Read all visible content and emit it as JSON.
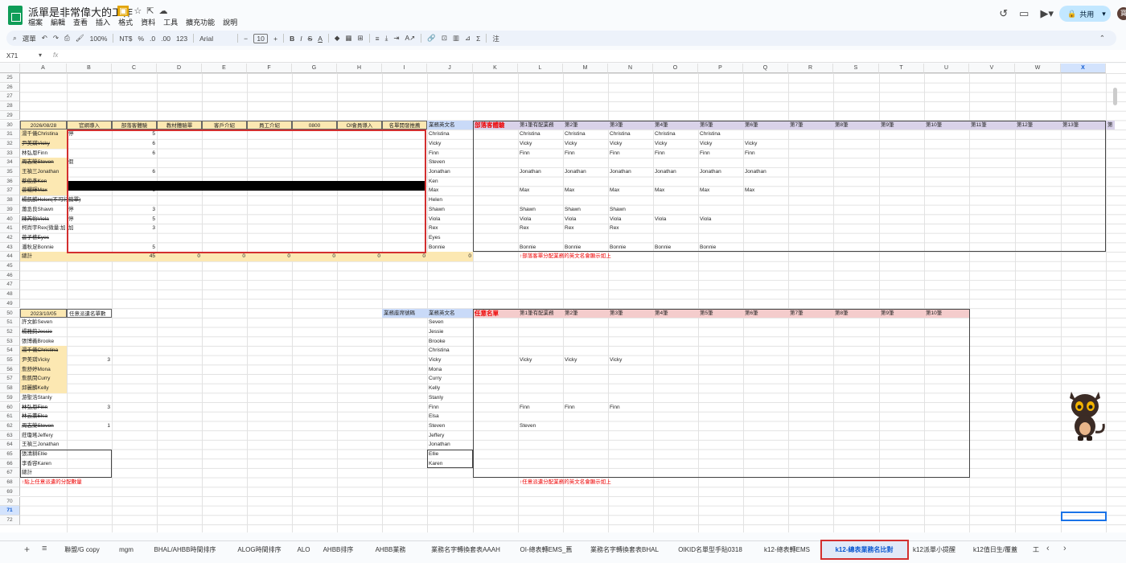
{
  "app": {
    "doc_title": "派單是非常偉大的工作",
    "menus": [
      "檔案",
      "編輯",
      "查看",
      "插入",
      "格式",
      "資料",
      "工具",
      "擴充功能",
      "說明"
    ],
    "share_label": "共用",
    "avatar_initial": "寶"
  },
  "toolbar": {
    "search": "選單",
    "zoom": "100%",
    "currency": "NT$",
    "percent": "%",
    "dec1": ".0",
    "dec2": ".00",
    "num123": "123",
    "font": "Arial",
    "fontsize": "10"
  },
  "formula": {
    "namebox": "X71",
    "fx": "fx"
  },
  "columns": [
    "A",
    "B",
    "C",
    "D",
    "E",
    "F",
    "G",
    "H",
    "I",
    "J",
    "K",
    "L",
    "M",
    "N",
    "O",
    "P",
    "Q",
    "R",
    "S",
    "T",
    "U",
    "V",
    "W",
    "X"
  ],
  "rows": [
    "25",
    "26",
    "27",
    "28",
    "29",
    "30",
    "31",
    "32",
    "33",
    "34",
    "35",
    "36",
    "37",
    "38",
    "39",
    "40",
    "41",
    "42",
    "43",
    "44",
    "45",
    "46",
    "47",
    "48",
    "49",
    "50",
    "51",
    "52",
    "53",
    "54",
    "55",
    "56",
    "57",
    "58",
    "59",
    "60",
    "61",
    "62",
    "63",
    "64",
    "65",
    "66",
    "67",
    "68",
    "69",
    "70",
    "71",
    "72"
  ],
  "top_table": {
    "date": "2026/08/28",
    "headers": [
      "官網導入",
      "部落客體驗",
      "教材體驗單",
      "客戶介紹",
      "員工介紹",
      "0800",
      "OI會員導入",
      "名單開發推薦",
      "業務英文名"
    ],
    "names": [
      "湯千儀Christina",
      "尹美琪Vicky",
      "林弘恩Finn",
      "周志榮Steven",
      "王禎三Jonathan",
      "蔡俊彥Ken",
      "曾耀輝Max",
      "楊凱麟Helen(不可行銷單)",
      "蕭丞良Shawn",
      "陳芮怡Viola",
      "柯尚宇Rex(微量:加",
      "曾子樵Eyes",
      "潘秋足Bonnie",
      "總計"
    ],
    "b_vals": [
      "停",
      "",
      "",
      "假",
      "",
      "",
      "",
      "",
      "停",
      "停",
      "加",
      "",
      "",
      ""
    ],
    "c_vals": [
      "5",
      "6",
      "6",
      "",
      "6",
      "",
      "6",
      "",
      "3",
      "5",
      "3",
      "",
      "5",
      "45"
    ],
    "totals": [
      "0",
      "0",
      "0",
      "0",
      "0",
      "0",
      "0"
    ],
    "english": [
      "Christina",
      "Vicky",
      "Finn",
      "Steven",
      "Jonathan",
      "Ken",
      "Max",
      "Helen",
      "Shawn",
      "Viola",
      "Rex",
      "Eyes",
      "Bonnie"
    ]
  },
  "blog_table": {
    "title": "部落客體驗",
    "headers": [
      "第1筆有配業務",
      "第2筆",
      "第3筆",
      "第4筆",
      "第5筆",
      "第6筆",
      "第7筆",
      "第8筆",
      "第9筆",
      "第10筆",
      "第11筆",
      "第12筆",
      "第13筆",
      "第"
    ],
    "rows": [
      [
        "Christina",
        "Christina",
        "Christina",
        "Christina",
        "Christina",
        ""
      ],
      [
        "Vicky",
        "Vicky",
        "Vicky",
        "Vicky",
        "Vicky",
        "Vicky"
      ],
      [
        "Finn",
        "Finn",
        "Finn",
        "Finn",
        "Finn",
        "Finn"
      ],
      [
        "",
        "",
        "",
        "",
        "",
        ""
      ],
      [
        "Jonathan",
        "Jonathan",
        "Jonathan",
        "Jonathan",
        "Jonathan",
        "Jonathan"
      ],
      [
        "",
        "",
        "",
        "",
        "",
        ""
      ],
      [
        "Max",
        "Max",
        "Max",
        "Max",
        "Max",
        "Max"
      ],
      [
        "",
        "",
        "",
        "",
        "",
        ""
      ],
      [
        "Shawn",
        "Shawn",
        "Shawn",
        "",
        "",
        ""
      ],
      [
        "Viola",
        "Viola",
        "Viola",
        "Viola",
        "Viola",
        ""
      ],
      [
        "Rex",
        "Rex",
        "Rex",
        "",
        "",
        ""
      ],
      [
        "",
        "",
        "",
        "",
        "",
        ""
      ],
      [
        "Bonnie",
        "Bonnie",
        "Bonnie",
        "Bonnie",
        "Bonnie",
        ""
      ]
    ],
    "note": "↑部落客單分配業務的英文名會顯示如上"
  },
  "bottom_table": {
    "date": "2023/10/05",
    "header": "任意派遣名單數",
    "names": [
      "許文齡Seven",
      "楊雅鈞Jessie",
      "張博義Brooke",
      "湯千儀Christina",
      "尹美琪Vicky",
      "詹舒婷Mona",
      "詹凱閔Curry",
      "邱麗麟Kelly",
      "游聖浩Stanly",
      "林弘恩Finn",
      "林云薰Elsa",
      "周志榮Steven",
      "莊瓊瑤Jeffery",
      "王禎三Jonathan",
      "張凊耕Ellie",
      "李香容Karen",
      "總計"
    ],
    "counts": [
      "",
      "",
      "",
      "",
      "3",
      "",
      "",
      "",
      "",
      "3",
      "",
      "1",
      "",
      "",
      "",
      "",
      ""
    ],
    "note": "↑貼上任意派遣的分配數量",
    "seat_label": "業務座席號碼",
    "english_label": "業務英文名",
    "english": [
      "Seven",
      "Jessie",
      "Brooke",
      "Christina",
      "Vicky",
      "Mona",
      "Curry",
      "Kelly",
      "Stanly",
      "Finn",
      "Elsa",
      "Steven",
      "Jeffery",
      "Jonathan",
      "Ellie",
      "Karen"
    ]
  },
  "any_table": {
    "title": "任意名單",
    "headers": [
      "第1筆有配業務",
      "第2筆",
      "第3筆",
      "第4筆",
      "第5筆",
      "第6筆",
      "第7筆",
      "第8筆",
      "第9筆",
      "第10筆"
    ],
    "rows": [
      [
        "",
        "",
        ""
      ],
      [
        "",
        "",
        ""
      ],
      [
        "",
        "",
        ""
      ],
      [
        "",
        "",
        ""
      ],
      [
        "Vicky",
        "Vicky",
        "Vicky"
      ],
      [
        "",
        "",
        ""
      ],
      [
        "",
        "",
        ""
      ],
      [
        "",
        "",
        ""
      ],
      [
        "",
        "",
        ""
      ],
      [
        "Finn",
        "Finn",
        "Finn"
      ],
      [
        "",
        "",
        ""
      ],
      [
        "Steven",
        "",
        ""
      ]
    ],
    "note": "↑任意派遣分配業務的英文名會顯示如上"
  },
  "tabs": [
    "聯盟/G copy",
    "mgm",
    "BHAL/AHBB時間排序",
    "ALOG時間排序",
    "ALO",
    "AHBB排序",
    "AHBB業務",
    "業務名字轉換套表AAAH",
    "OI-總表轉EMS_舊",
    "業務名字轉換套表BHAL",
    "OIKID名單型手貼0318",
    "k12-總表轉EMS",
    "k12-總表業務名比對",
    "k12派單小提醒",
    "k12值日生/覆蓋",
    "工"
  ],
  "active_tab": "k12-總表業務名比對"
}
